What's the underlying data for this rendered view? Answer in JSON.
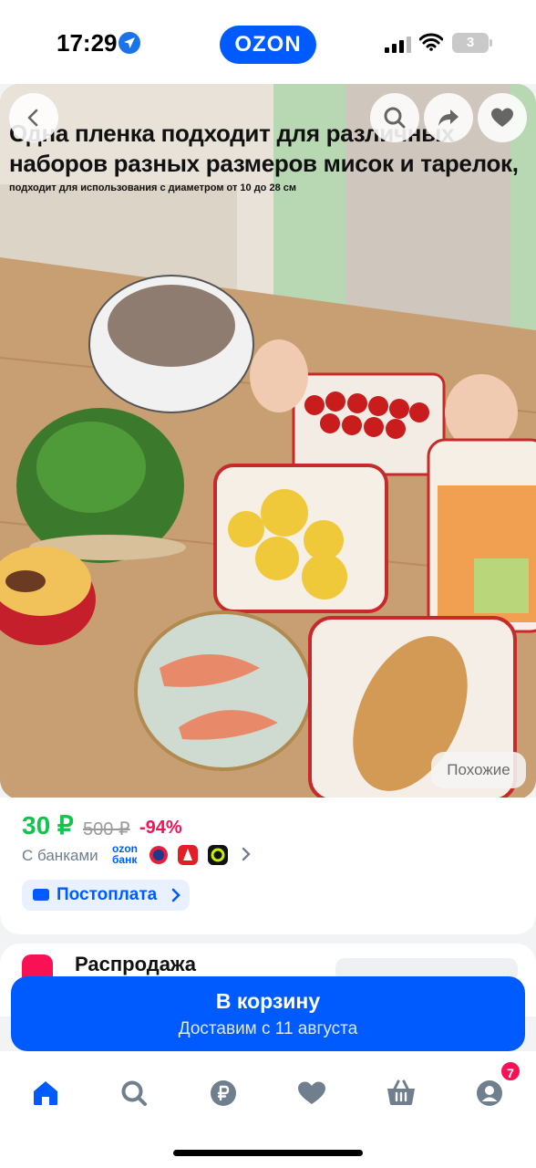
{
  "status_bar": {
    "time": "17:29",
    "brand": "OZON",
    "battery": "3"
  },
  "hero": {
    "title": "Одна пленка подходит для различных наборов разных размеров мисок и тарелок,",
    "subtitle": "подходит для использования с диаметром от 10 до 28 см",
    "similar_label": "Похожие",
    "icons": [
      "back-icon",
      "search-icon",
      "share-icon",
      "heart-icon"
    ]
  },
  "price": {
    "current": "30 ₽",
    "old": "500 ₽",
    "discount": "-94%",
    "banks_label": "С банками",
    "ozon_bank_line1": "ozon",
    "ozon_bank_line2": "банк",
    "postpay_label": "Постоплата"
  },
  "sale": {
    "label": "Распродажа"
  },
  "cart": {
    "label": "В корзину",
    "delivery": "Доставим с 11 августа"
  },
  "nav": {
    "items": [
      "home-icon",
      "search-icon",
      "ruble-icon",
      "heart-icon",
      "basket-icon",
      "profile-icon"
    ],
    "profile_badge": "7"
  },
  "colors": {
    "brand": "#005bff",
    "price_green": "#10c44c",
    "discount_pink": "#f91155"
  }
}
